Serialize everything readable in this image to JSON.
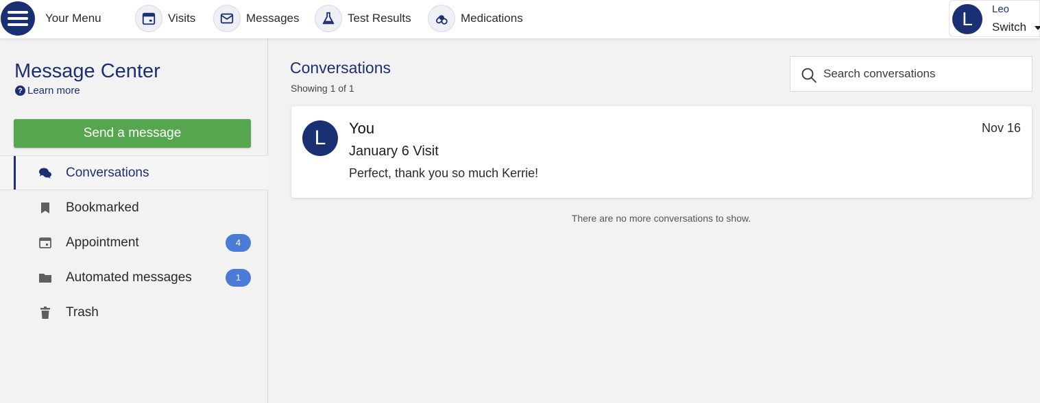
{
  "topbar": {
    "menu_label": "Your Menu",
    "nav": [
      {
        "label": "Visits",
        "icon": "calendar-icon"
      },
      {
        "label": "Messages",
        "icon": "envelope-icon"
      },
      {
        "label": "Test Results",
        "icon": "flask-icon"
      },
      {
        "label": "Medications",
        "icon": "pills-icon"
      }
    ],
    "account": {
      "initial": "L",
      "name": "Leo",
      "switch_label": "Switch"
    }
  },
  "sidebar": {
    "title": "Message Center",
    "learn_more": "Learn more",
    "send_button": "Send a message",
    "folders": [
      {
        "label": "Conversations",
        "icon": "chat-bubbles-icon",
        "active": true
      },
      {
        "label": "Bookmarked",
        "icon": "bookmark-icon"
      },
      {
        "label": "Appointment",
        "icon": "calendar-icon",
        "badge": "4"
      },
      {
        "label": "Automated messages",
        "icon": "folder-icon",
        "badge": "1"
      },
      {
        "label": "Trash",
        "icon": "trash-icon"
      }
    ]
  },
  "main": {
    "title": "Conversations",
    "count": "Showing 1 of 1",
    "search_placeholder": "Search conversations",
    "conversations": [
      {
        "avatar_initial": "L",
        "sender": "You",
        "subject": "January 6 Visit",
        "preview": "Perfect, thank you so much Kerrie!",
        "date": "Nov 16"
      }
    ],
    "end_text": "There are no more conversations to show."
  },
  "colors": {
    "brand_navy": "#1b2f73",
    "send_green": "#55a64e",
    "badge_blue": "#4a7bd6"
  }
}
